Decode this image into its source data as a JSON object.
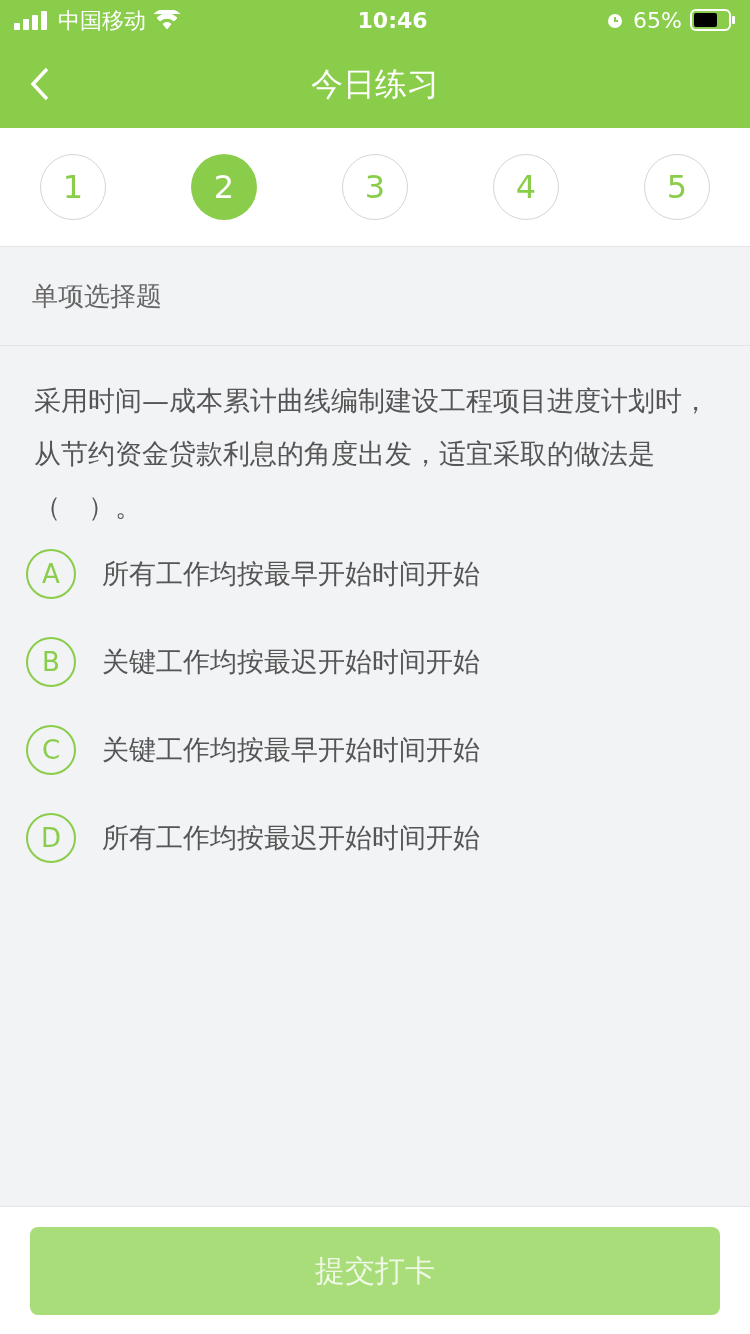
{
  "status_bar": {
    "carrier": "中国移动",
    "time": "10:46",
    "battery": "65%"
  },
  "nav": {
    "title": "今日练习"
  },
  "steps": [
    {
      "label": "1",
      "selected": false
    },
    {
      "label": "2",
      "selected": true
    },
    {
      "label": "3",
      "selected": false
    },
    {
      "label": "4",
      "selected": false
    },
    {
      "label": "5",
      "selected": false
    }
  ],
  "question_type": "单项选择题",
  "question": "采用时间—成本累计曲线编制建设工程项目进度计划时，从节约资金贷款利息的角度出发，适宜采取的做法是（　）。",
  "options": [
    {
      "letter": "A",
      "text": "所有工作均按最早开始时间开始",
      "selected": false
    },
    {
      "letter": "B",
      "text": "关键工作均按最迟开始时间开始",
      "selected": false
    },
    {
      "letter": "C",
      "text": "关键工作均按最早开始时间开始",
      "selected": false
    },
    {
      "letter": "D",
      "text": "所有工作均按最迟开始时间开始",
      "selected": false
    }
  ],
  "submit": {
    "label": "提交打卡",
    "disabled": true
  }
}
